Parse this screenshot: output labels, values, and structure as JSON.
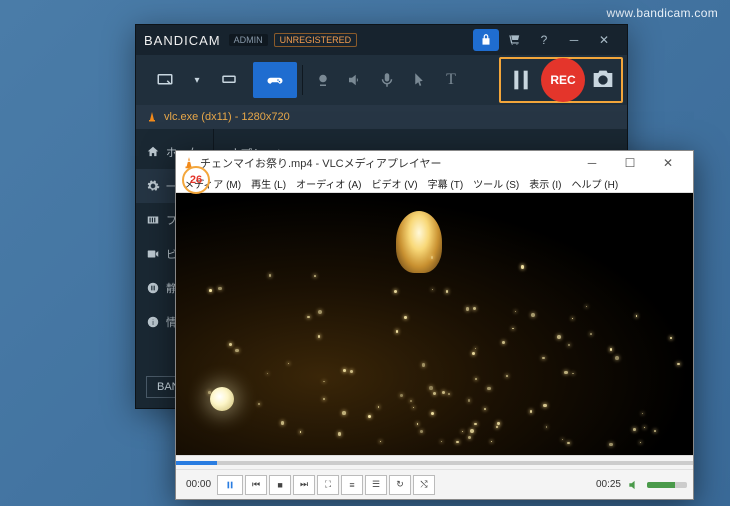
{
  "watermark": "www.bandicam.com",
  "bandicam": {
    "brand": "BANDI",
    "brand2": "CAM",
    "admin": "ADMIN",
    "unregistered": "UNREGISTERED",
    "target": "vlc.exe (dx11) - 1280x720",
    "rec_label": "REC",
    "main_title": "オプション",
    "logo_bar": "BANDI",
    "fps_overlay": "26",
    "sidebar": [
      {
        "label": "ホーム",
        "icon": "home"
      },
      {
        "label": "一般",
        "icon": "gear",
        "active": true
      },
      {
        "label": "フレ",
        "icon": "film"
      },
      {
        "label": "ビデ",
        "icon": "video"
      },
      {
        "label": "静止",
        "icon": "pause-circle"
      },
      {
        "label": "情報",
        "icon": "info"
      }
    ]
  },
  "vlc": {
    "title": "チェンマイお祭り.mp4 - VLCメディアプレイヤー",
    "menu": [
      "メディア (M)",
      "再生 (L)",
      "オーディオ (A)",
      "ビデオ (V)",
      "字幕 (T)",
      "ツール (S)",
      "表示 (I)",
      "ヘルプ (H)"
    ],
    "time_current": "00:00",
    "time_total": "00:25"
  }
}
